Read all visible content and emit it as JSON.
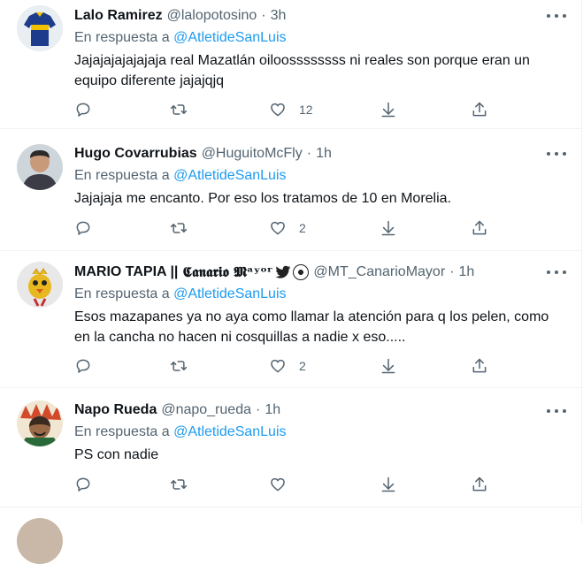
{
  "reply_prefix": "En respuesta a",
  "colors": {
    "accent": "#1d9bf0",
    "muted": "#536471",
    "text": "#0f1419",
    "border": "#eff3f4"
  },
  "tweets": [
    {
      "name": "Lalo Ramirez",
      "handle": "@lalopotosino",
      "sep": "·",
      "time": "3h",
      "mention": "@AtletideSanLuis",
      "text": "Jajajajajajajaja real Mazatlán oiloossssssss ni reales son porque eran un equipo diferente jajajqjq",
      "likes": "12",
      "avatar": "jersey-avatar"
    },
    {
      "name": "Hugo Covarrubias",
      "handle": "@HuguitoMcFly",
      "sep": "·",
      "time": "1h",
      "mention": "@AtletideSanLuis",
      "text": "Jajajaja me encanto. Por eso los tratamos de 10 en Morelia.",
      "likes": "2",
      "avatar": "photo-avatar"
    },
    {
      "name": "MARIO TAPIA ||",
      "name_suffix": "𝕮𝖆𝖓𝖆𝖗𝖎𝖔 𝕸ᵃʸᵒʳ",
      "handle": "@MT_CanarioMayor",
      "sep": "·",
      "time": "1h",
      "mention": "@AtletideSanLuis",
      "text": "Esos mazapanes ya no aya como llamar la atención para q los pelen, como en la cancha no hacen ni cosquillas a nadie x eso.....",
      "likes": "2",
      "avatar": "canary-avatar"
    },
    {
      "name": "Napo Rueda",
      "handle": "@napo_rueda",
      "sep": "·",
      "time": "1h",
      "mention": "@AtletideSanLuis",
      "text": "PS con nadie",
      "likes": "",
      "avatar": "art-avatar"
    }
  ]
}
